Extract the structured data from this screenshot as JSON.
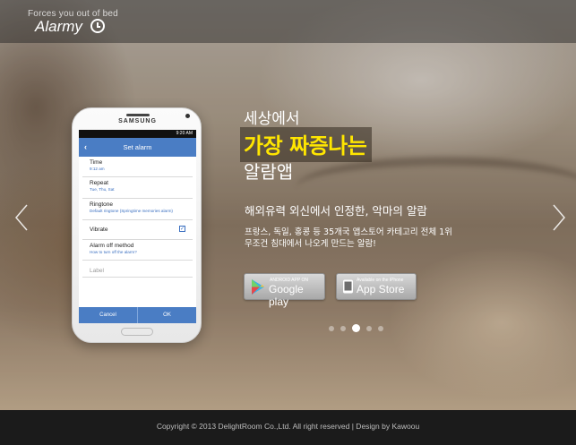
{
  "header": {
    "tagline": "Forces you out of bed",
    "logo_text": "Alarmy"
  },
  "phone": {
    "brand": "SAMSUNG",
    "status_time": "9:20 AM",
    "app_title": "Set alarm",
    "settings": [
      {
        "title": "Time",
        "subtitle": "9:12 am"
      },
      {
        "title": "Repeat",
        "subtitle": "Tue, Thu, Sat"
      },
      {
        "title": "Ringtone",
        "subtitle": "Default ringtone (Springtime memories alarm)"
      },
      {
        "title": "Vibrate",
        "subtitle": "",
        "checked": true
      },
      {
        "title": "Alarm off method",
        "subtitle": "How to turn off the alarm?"
      }
    ],
    "label_placeholder": "Label",
    "cancel_label": "Cancel",
    "ok_label": "OK"
  },
  "hero": {
    "line1": "세상에서",
    "line2": "가장 짜증나는",
    "line3": "알람앱",
    "subtitle": "해외유력 외신에서 인정한, 악마의 알람",
    "desc_line1": "프랑스, 독일, 홍콩 등 35개국 앱스토어 카테고리 전체 1위",
    "desc_line2": "무조건 침대에서 나오게 만드는 알람!",
    "highlight_color": "#ffe600"
  },
  "stores": {
    "google": {
      "small": "ANDROID APP ON",
      "big": "Google play"
    },
    "apple": {
      "small": "Available on the iPhone",
      "big": "App Store"
    }
  },
  "carousel": {
    "total": 5,
    "active_index": 2
  },
  "footer": {
    "copyright": "Copyright © 2013 DelightRoom Co.,Ltd. All right reserved | Design by Kawoou"
  },
  "colors": {
    "app_blue": "#4a7dc4",
    "footer_bg": "#1b1b1b"
  }
}
